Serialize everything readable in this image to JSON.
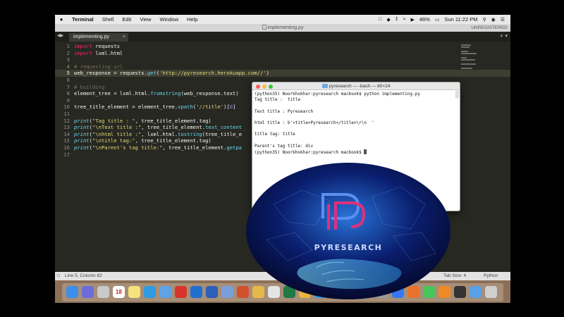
{
  "menubar": {
    "apple": "",
    "items": [
      "Terminal",
      "Shell",
      "Edit",
      "View",
      "Window",
      "Help"
    ],
    "battery": "46%",
    "clock": "Sun 11:22 PM"
  },
  "window": {
    "title": "implementing.py",
    "registered": "UNREGISTERED"
  },
  "tab": {
    "label": "implementing.py",
    "close": "×"
  },
  "editor": {
    "line_numbers": [
      "1",
      "2",
      "3",
      "4",
      "5",
      "6",
      "7",
      "8",
      "9",
      "10",
      "11",
      "12",
      "13",
      "14",
      "15",
      "16",
      "17"
    ],
    "current_line": 5
  },
  "statusbar": {
    "position": "Line 5, Column 62",
    "tab_size": "Tab Size: 4",
    "syntax": "Python"
  },
  "terminal": {
    "title": "pyresearch — -bash — 80×24",
    "lines": [
      "(python35) Noorkhokhar:pyresearch macbook$ python implementing.py",
      "Tag title :  title",
      "",
      "Text title : Pyresearch",
      "",
      "html title : b'<title>Pyresearch</title>\\r\\n  '",
      "",
      "title tag: title",
      "",
      "Parent's tag title: div",
      "(python35) Noorkhokhar:pyresearch macbook$ "
    ]
  },
  "logo": {
    "text": "PYRESEARCH",
    "accent": "#e0307a",
    "primary": "#5a8ef0"
  },
  "dock": {
    "calendar_day": "18",
    "icons": [
      "finder-icon",
      "siri-icon",
      "launchpad-icon",
      "calendar-icon",
      "notes-icon",
      "safari-icon",
      "mail-icon",
      "pdf-icon",
      "teamviewer-icon",
      "word-icon",
      "preview-icon",
      "powerpoint-icon",
      "photos-icon",
      "chrome-icon",
      "excel-icon",
      "chrome-canary-icon",
      "skype-icon",
      "files-icon",
      "contacts-icon",
      "folder-icon",
      "settings-icon",
      "appstore-icon",
      "firefox-icon",
      "messages-icon",
      "sublime-icon",
      "terminal-icon",
      "downloads-icon",
      "trash-icon"
    ]
  }
}
